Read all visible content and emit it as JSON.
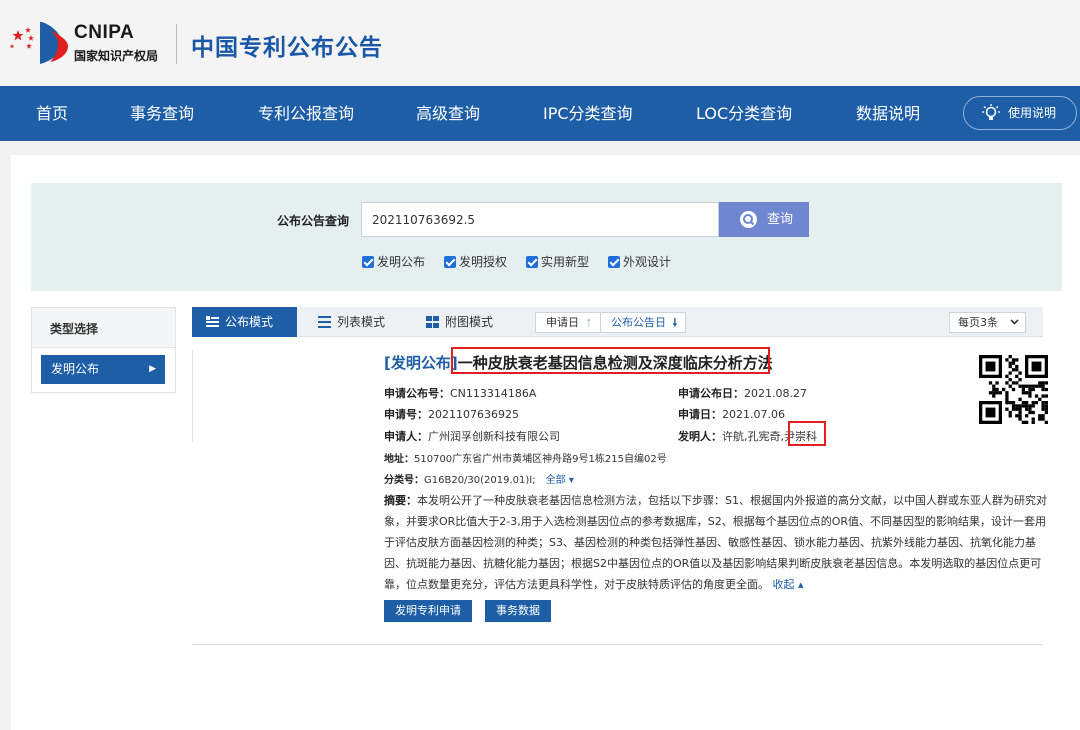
{
  "header": {
    "logo_en": "CNIPA",
    "logo_cn": "国家知识产权局",
    "site_title": "中国专利公布公告"
  },
  "nav": {
    "items": [
      "首页",
      "事务查询",
      "专利公报查询",
      "高级查询",
      "IPC分类查询",
      "LOC分类查询",
      "数据说明"
    ],
    "help": "使用说明",
    "help_icon": "lightbulb-icon"
  },
  "search": {
    "label": "公布公告查询",
    "value": "202110763692.5",
    "button": "查询",
    "button_icon": "search-icon",
    "checkboxes": [
      {
        "label": "发明公布",
        "checked": true
      },
      {
        "label": "发明授权",
        "checked": true
      },
      {
        "label": "实用新型",
        "checked": true
      },
      {
        "label": "外观设计",
        "checked": true
      }
    ]
  },
  "sidebar": {
    "title": "类型选择",
    "active": "发明公布"
  },
  "toolbar": {
    "modes": [
      "公布模式",
      "列表模式",
      "附图模式"
    ],
    "active_mode": "公布模式",
    "sort_a": "申请日",
    "sort_b": "公布公告日",
    "per_page": "每页3条"
  },
  "result": {
    "type_tag": "[发明公布]",
    "title": "一种皮肤衰老基因信息检测及深度临床分析方法",
    "pub_no_label": "申请公布号：",
    "pub_no": "CN113314186A",
    "pub_date_label": "申请公布日：",
    "pub_date": "2021.08.27",
    "app_no_label": "申请号：",
    "app_no": "2021107636925",
    "app_date_label": "申请日：",
    "app_date": "2021.07.06",
    "applicant_label": "申请人：",
    "applicant": "广州润孚创新科技有限公司",
    "inventor_label": "发明人：",
    "inventors": "许航,孔宪奇,",
    "inventor_highlight": "尹崇科",
    "address_label": "地址：",
    "address": "510700广东省广州市黄埔区神舟路9号1栋215自编02号",
    "class_label": "分类号：",
    "class_value": "G16B20/30(2019.01)I;",
    "class_more": "全部 ▾",
    "abstract_label": "摘要：",
    "abstract": "本发明公开了一种皮肤衰老基因信息检测方法，包括以下步骤：S1、根据国内外报道的高分文献，以中国人群或东亚人群为研究对象，并要求OR比值大于2-3,用于入选检测基因位点的参考数据库，S2、根据每个基因位点的OR值、不同基因型的影响结果，设计一套用于评估皮肤方面基因检测的种类；S3、基因检测的种类包括弹性基因、敏感性基因、锁水能力基因、抗紫外线能力基因、抗氧化能力基因、抗斑能力基因、抗糖化能力基因；根据S2中基因位点的OR值以及基因影响结果判断皮肤衰老基因信息。本发明选取的基因位点更可靠，位点数量更充分，评估方法更具科学性，对于皮肤特质评估的角度更全面。",
    "collapse": "收起 ▴",
    "buttons": [
      "发明专利申请",
      "事务数据"
    ]
  }
}
